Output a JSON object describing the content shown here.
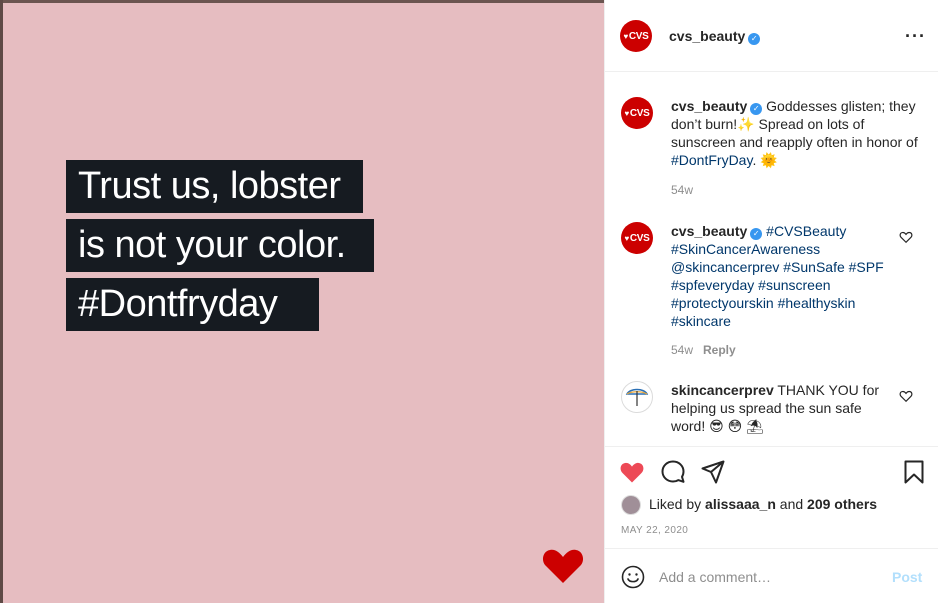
{
  "image": {
    "headline_lines": [
      "Trust us, lobster",
      "is not your color.",
      "#Dontfryday"
    ],
    "background_color": "#e6bdc1",
    "logo_icon": "cvs-heart-icon"
  },
  "header": {
    "avatar_text": "CVS",
    "username": "cvs_beauty",
    "more_icon": "more-options-icon"
  },
  "comments": [
    {
      "username": "cvs_beauty",
      "avatar_text": "CVS",
      "text_before": " Goddesses glisten; they don’t burn!✨ Spread on lots of sunscreen and reapply often in honor of ",
      "tag": "#DontFryDay",
      "text_after": ". 🌞",
      "time": "54w"
    },
    {
      "username": "cvs_beauty",
      "avatar_text": "CVS",
      "tags": "#CVSBeauty #SkinCancerAwareness @skincancerprev #SunSafe #SPF #spfeveryday #sunscreen #protectyourskin #healthyskin #skincare",
      "time": "54w",
      "reply": "Reply"
    },
    {
      "username": "skincancerprev",
      "text": " THANK YOU for helping us spread the sun safe word! 😎 😳 ⛱"
    }
  ],
  "actions": {
    "liked_by_prefix": "Liked by ",
    "liked_by_user": "alissaaa_n",
    "liked_by_mid": " and ",
    "liked_by_others": "209 others",
    "date": "MAY 22, 2020",
    "comment_placeholder": "Add a comment…",
    "post_label": "Post"
  },
  "colors": {
    "like_red": "#ed4956",
    "brand_red": "#cc0000",
    "verified_blue": "#3897f0",
    "link_blue": "#00376b",
    "post_disabled": "#b2dffc"
  }
}
